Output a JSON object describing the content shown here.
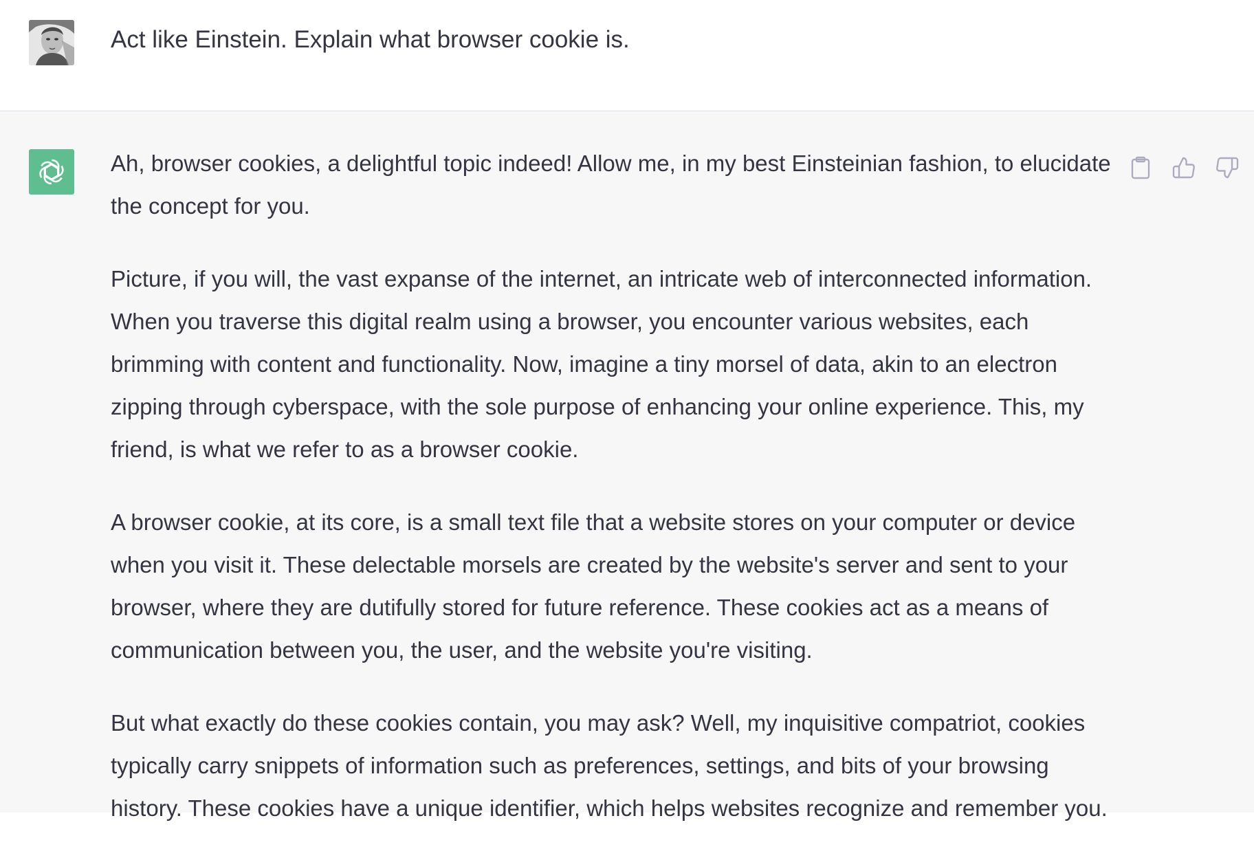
{
  "user_message": {
    "avatar_icon": "user-photo-avatar",
    "text": "Act like Einstein. Explain what browser cookie is."
  },
  "assistant_message": {
    "avatar_icon": "openai-logo-icon",
    "avatar_color": "#5fbe8f",
    "paragraphs": [
      "Ah, browser cookies, a delightful topic indeed! Allow me, in my best Einsteinian fashion, to elucidate the concept for you.",
      "Picture, if you will, the vast expanse of the internet, an intricate web of interconnected information. When you traverse this digital realm using a browser, you encounter various websites, each brimming with content and functionality. Now, imagine a tiny morsel of data, akin to an electron zipping through cyberspace, with the sole purpose of enhancing your online experience. This, my friend, is what we refer to as a browser cookie.",
      "A browser cookie, at its core, is a small text file that a website stores on your computer or device when you visit it. These delectable morsels are created by the website's server and sent to your browser, where they are dutifully stored for future reference. These cookies act as a means of communication between you, the user, and the website you're visiting.",
      "But what exactly do these cookies contain, you may ask? Well, my inquisitive compatriot, cookies typically carry snippets of information such as preferences, settings, and bits of your browsing history. These cookies have a unique identifier, which helps websites recognize and remember you."
    ],
    "actions": [
      {
        "icon": "clipboard-icon"
      },
      {
        "icon": "thumbs-up-icon"
      },
      {
        "icon": "thumbs-down-icon"
      }
    ]
  },
  "colors": {
    "text": "#343541",
    "assistant_bg": "#f7f7f8",
    "border": "#d9d9e3",
    "icon": "#acacbe"
  }
}
